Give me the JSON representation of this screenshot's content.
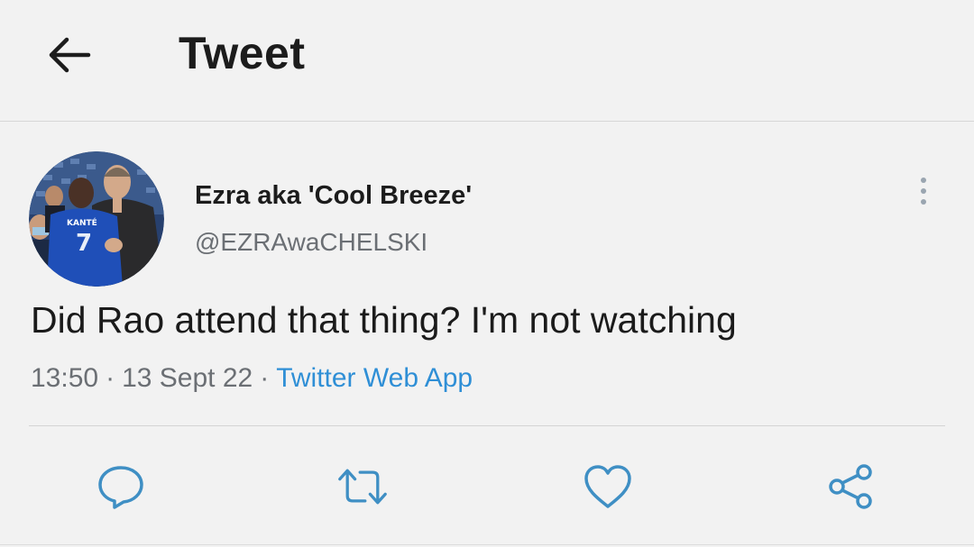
{
  "header": {
    "title": "Tweet",
    "back_icon": "arrow-left-icon"
  },
  "tweet": {
    "display_name": "Ezra aka 'Cool Breeze'",
    "handle": "@EZRAwaCHELSKI",
    "text": "Did Rao attend that thing? I'm not watching",
    "time": "13:50",
    "date": "13 Sept 22",
    "separator": "·",
    "source": "Twitter Web App",
    "avatar": {
      "jersey_name": "KANTÉ",
      "jersey_number": "7"
    }
  },
  "actions": [
    {
      "name": "reply",
      "icon": "reply-icon"
    },
    {
      "name": "retweet",
      "icon": "retweet-icon"
    },
    {
      "name": "like",
      "icon": "heart-icon"
    },
    {
      "name": "share",
      "icon": "share-icon"
    }
  ],
  "colors": {
    "background": "#f2f2f2",
    "text_primary": "#1b1b1b",
    "text_secondary": "#6b6f74",
    "link": "#2f8fd6",
    "icon": "#3f8fc4",
    "divider": "#d4d4d4"
  }
}
